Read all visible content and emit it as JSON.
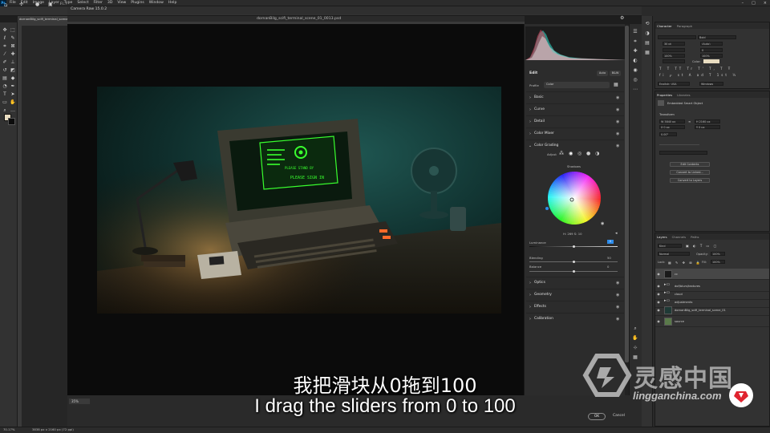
{
  "menubar": {
    "items": [
      "File",
      "Edit",
      "Image",
      "Layer",
      "Type",
      "Select",
      "Filter",
      "3D",
      "View",
      "Plugins",
      "Window",
      "Help"
    ],
    "controls": [
      "–",
      "□",
      "×"
    ]
  },
  "options_bar": {
    "text": "Fl..."
  },
  "document_tab": {
    "label": "dornanBilg_scifi_terminal_scene_01_0013.psb"
  },
  "camera_raw": {
    "title": "Camera Raw 15.0.2",
    "filename": "dornanBilg_scifi_terminal_scene_01_0013.psd",
    "zoom": "35%",
    "edit_label": "Edit",
    "auto_label": "Auto",
    "bw_label": "B&W",
    "profile_label": "Profile",
    "profile_value": "Color",
    "sections_top": [
      "Basic",
      "Curve",
      "Detail",
      "Color Mixer"
    ],
    "color_grading": {
      "title": "Color Grading",
      "adjust_label": "Adjust",
      "wheel_label": "Shadows",
      "hue_sat": "H: 269   S: 10",
      "luminance_label": "Luminance",
      "luminance_value": "0",
      "blending_label": "Blending",
      "blending_value": "50",
      "balance_label": "Balance",
      "balance_value": "0"
    },
    "sections_bottom": [
      "Optics",
      "Geometry",
      "Effects",
      "Calibration"
    ],
    "ok_label": "OK",
    "cancel_label": "Cancel"
  },
  "photo": {
    "screen_text_1": "PLEASE STAND BY",
    "screen_text_2": "PLEASE SIGN IN"
  },
  "character_panel": {
    "tabs": [
      "Character",
      "Paragraph"
    ],
    "font": "Bold",
    "size": "30 pt",
    "leading": "(Auto)",
    "tracking": "0",
    "scale": "100%",
    "color_label": "Color:",
    "language": "English: USA",
    "aa": "Windows"
  },
  "properties_panel": {
    "tabs": [
      "Properties",
      "Libraries"
    ],
    "type": "Embedded Smart Object",
    "transform_label": "Transform",
    "w": "W  3840 px",
    "h": "H  2160 px",
    "x": "X  0 px",
    "y": "Y  0 px",
    "angle": "0.00°",
    "buttons": [
      "Edit Contents",
      "Convert to Linked...",
      "Convert to Layers"
    ]
  },
  "layers_panel": {
    "tabs": [
      "Layers",
      "Channels",
      "Paths"
    ],
    "kind": "Kind",
    "blend_mode": "Normal",
    "opacity_label": "Opacity:",
    "opacity": "100%",
    "lock_label": "Lock:",
    "fill_label": "Fill:",
    "fill": "100%",
    "layers": [
      "cc",
      "dof/blurs/textures",
      "cloud",
      "adjustments",
      "dornanBilg_scifi_terminal_scene_01",
      "source"
    ]
  },
  "status_bar": {
    "zoom": "70.17%",
    "doc": "3838 px x 2160 px (72 ppi)"
  },
  "subtitles": {
    "zh": "我把滑块从0拖到100",
    "en": "I drag the sliders from 0 to 100"
  },
  "watermark": {
    "text": "灵感中国",
    "url": "lingganchina.com"
  },
  "colors": {
    "fg_swatch": "#e8dcc0",
    "bg_swatch": "#0c0c0c",
    "monitor_green": "#39ff2e",
    "blue_accent": "#2d8ceb",
    "badge_red": "#e0242f"
  }
}
